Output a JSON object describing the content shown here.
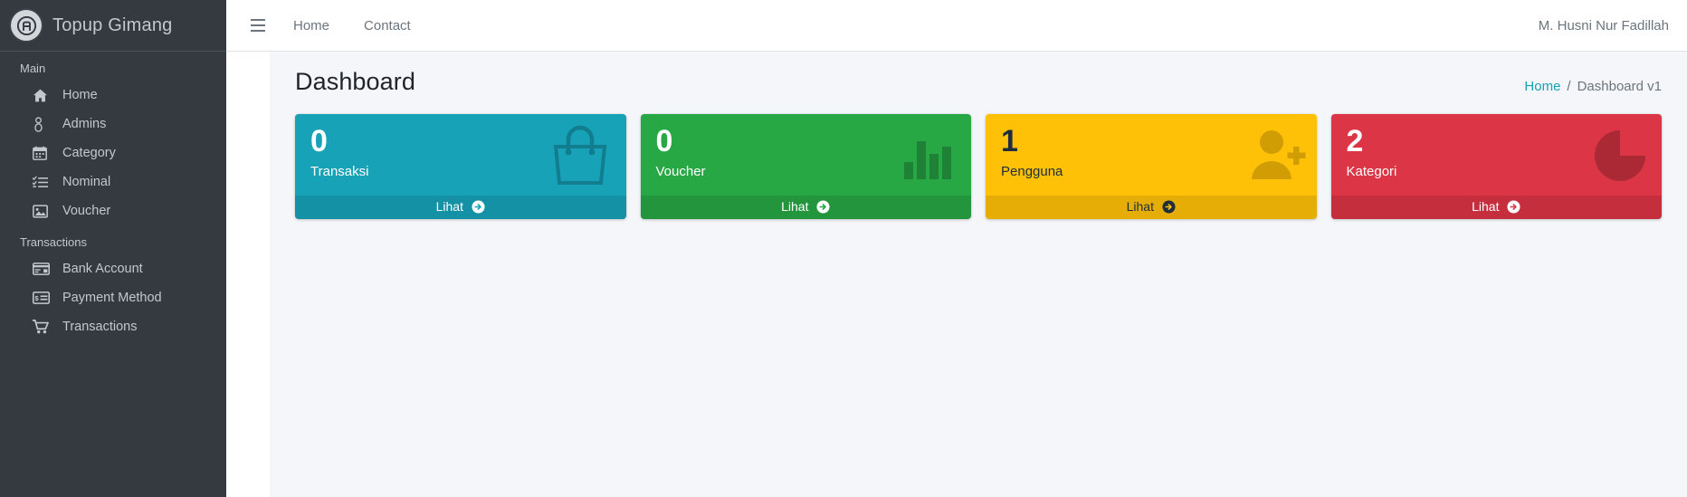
{
  "sidebar": {
    "brand": {
      "title": "Topup Gimang",
      "logo_icon": "app-circle-logo-icon"
    },
    "sections": [
      {
        "header": "Main",
        "items": [
          {
            "label": "Home",
            "icon": "home-icon"
          },
          {
            "label": "Admins",
            "icon": "user-icon"
          },
          {
            "label": "Category",
            "icon": "calendar-icon"
          },
          {
            "label": "Nominal",
            "icon": "list-check-icon"
          },
          {
            "label": "Voucher",
            "icon": "image-icon"
          }
        ]
      },
      {
        "header": "Transactions",
        "items": [
          {
            "label": "Bank Account",
            "icon": "credit-card-icon"
          },
          {
            "label": "Payment Method",
            "icon": "money-check-icon"
          },
          {
            "label": "Transactions",
            "icon": "shopping-cart-icon"
          }
        ]
      }
    ]
  },
  "navbar": {
    "toggle_icon": "hamburger-menu-icon",
    "links": [
      {
        "label": "Home"
      },
      {
        "label": "Contact"
      }
    ],
    "user": "M. Husni Nur Fadillah"
  },
  "content": {
    "page_title": "Dashboard",
    "breadcrumb": {
      "home": "Home",
      "separator": "/",
      "current": "Dashboard v1"
    },
    "cards": [
      {
        "number": "0",
        "label": "Transaksi",
        "footer": "Lihat",
        "icon": "shopping-bag-icon",
        "color": "#17a2b8",
        "text_mode": "light"
      },
      {
        "number": "0",
        "label": "Voucher",
        "footer": "Lihat",
        "icon": "bar-chart-icon",
        "color": "#28a745",
        "text_mode": "light"
      },
      {
        "number": "1",
        "label": "Pengguna",
        "footer": "Lihat",
        "icon": "user-plus-icon",
        "color": "#ffc107",
        "text_mode": "dark"
      },
      {
        "number": "2",
        "label": "Kategori",
        "footer": "Lihat",
        "icon": "pie-chart-icon",
        "color": "#dc3545",
        "text_mode": "light"
      }
    ]
  },
  "colors": {
    "sidebar_bg": "#343a40",
    "sidebar_text": "#c2c7d0",
    "content_bg": "#f4f6f9",
    "accent_link": "#17a2b8",
    "muted_text": "#6c757d"
  }
}
